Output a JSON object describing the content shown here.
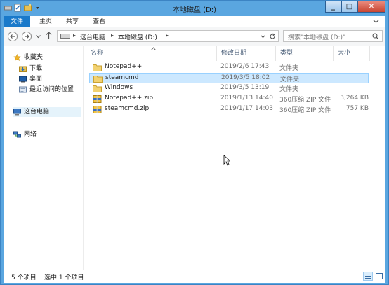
{
  "window": {
    "title": "本地磁盘 (D:)",
    "minimize_label": "_",
    "maximize_label": "□",
    "close_label": "✕"
  },
  "ribbon": {
    "tabs": [
      "文件",
      "主页",
      "共享",
      "查看"
    ]
  },
  "address": {
    "segments": [
      "这台电脑",
      "本地磁盘 (D:)"
    ],
    "separator": "▸",
    "search_placeholder": "搜索\"本地磁盘 (D:)\""
  },
  "nav_pane": {
    "items": [
      {
        "label": "收藏夹",
        "icon": "star-icon"
      },
      {
        "label": "下载",
        "icon": "download-folder-icon"
      },
      {
        "label": "桌面",
        "icon": "desktop-icon"
      },
      {
        "label": "最近访问的位置",
        "icon": "recent-places-icon"
      },
      {
        "label": "这台电脑",
        "icon": "computer-icon"
      },
      {
        "label": "网络",
        "icon": "network-icon"
      }
    ]
  },
  "columns": [
    "名称",
    "修改日期",
    "类型",
    "大小"
  ],
  "files": [
    {
      "name": "Notepad++",
      "date": "2019/2/6 17:43",
      "type": "文件夹",
      "size": "",
      "icon": "folder-icon",
      "selected": false
    },
    {
      "name": "steamcmd",
      "date": "2019/3/5 18:02",
      "type": "文件夹",
      "size": "",
      "icon": "folder-icon",
      "selected": true
    },
    {
      "name": "Windows",
      "date": "2019/3/5 13:19",
      "type": "文件夹",
      "size": "",
      "icon": "folder-icon",
      "selected": false
    },
    {
      "name": "Notepad++.zip",
      "date": "2019/1/13 14:40",
      "type": "360压缩 ZIP 文件",
      "size": "3,264 KB",
      "icon": "zip-icon",
      "selected": false
    },
    {
      "name": "steamcmd.zip",
      "date": "2019/1/17 14:03",
      "type": "360压缩 ZIP 文件",
      "size": "757 KB",
      "icon": "zip-icon",
      "selected": false
    }
  ],
  "status": {
    "item_count": "5 个项目",
    "selection": "选中 1 个项目"
  },
  "colors": {
    "title_bar": "#5aa6e0",
    "file_tab": "#1979ca",
    "selection": "#cce8ff",
    "folder": "#e8c155"
  }
}
